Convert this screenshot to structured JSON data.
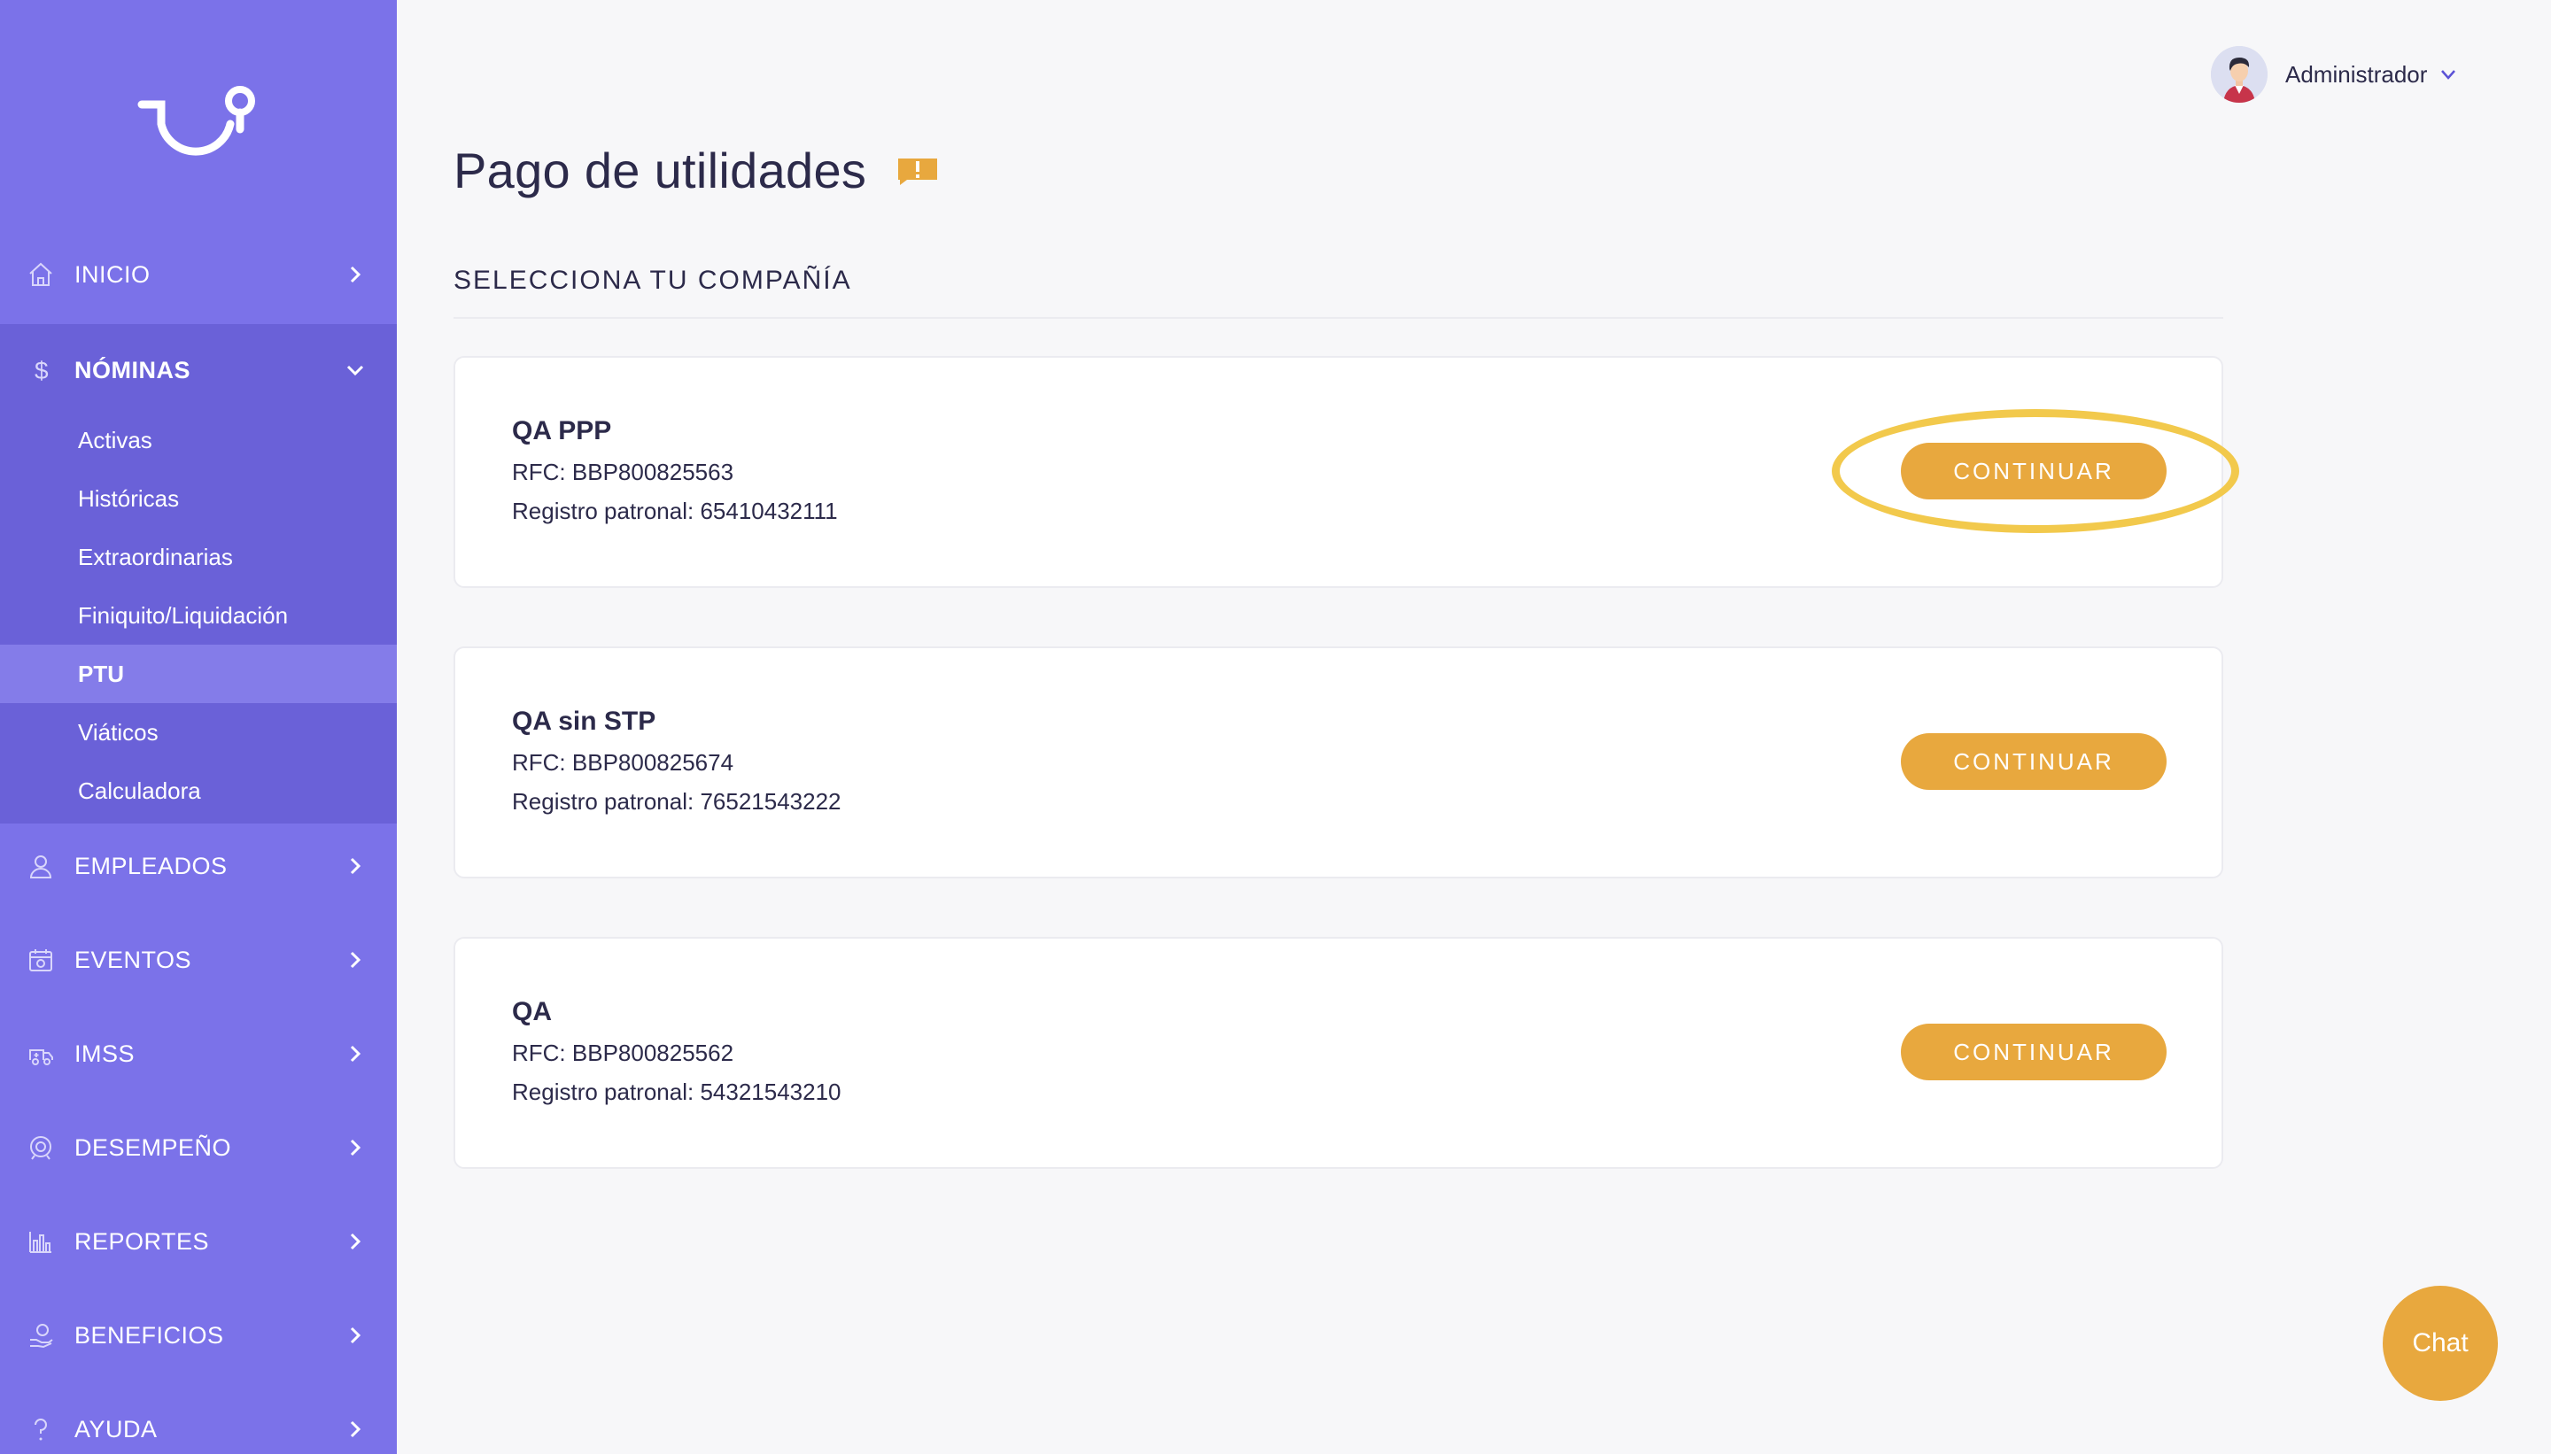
{
  "sidebar": {
    "items": [
      {
        "label": "INICIO",
        "icon": "home-icon"
      },
      {
        "label": "NÓMINAS",
        "icon": "dollar-icon"
      },
      {
        "label": "EMPLEADOS",
        "icon": "user-icon"
      },
      {
        "label": "EVENTOS",
        "icon": "calendar-icon"
      },
      {
        "label": "IMSS",
        "icon": "ambulance-icon"
      },
      {
        "label": "DESEMPEÑO",
        "icon": "performance-icon"
      },
      {
        "label": "REPORTES",
        "icon": "bar-chart-icon"
      },
      {
        "label": "BENEFICIOS",
        "icon": "benefits-icon"
      },
      {
        "label": "AYUDA",
        "icon": "help-icon"
      }
    ],
    "submenu": [
      "Activas",
      "Históricas",
      "Extraordinarias",
      "Finiquito/Liquidación",
      "PTU",
      "Viáticos",
      "Calculadora"
    ],
    "active_submenu": "PTU"
  },
  "header": {
    "user_name": "Administrador"
  },
  "main": {
    "title": "Pago de utilidades",
    "section_title": "SELECCIONA TU COMPAÑÍA",
    "companies": [
      {
        "name": "QA PPP",
        "rfc": "RFC: BBP800825563",
        "registro": "Registro patronal: 65410432111",
        "button": "CONTINUAR"
      },
      {
        "name": "QA sin STP",
        "rfc": "RFC: BBP800825674",
        "registro": "Registro patronal: 76521543222",
        "button": "CONTINUAR"
      },
      {
        "name": "QA",
        "rfc": "RFC: BBP800825562",
        "registro": "Registro patronal: 54321543210",
        "button": "CONTINUAR"
      }
    ]
  },
  "chat": {
    "label": "Chat"
  },
  "colors": {
    "sidebar": "#7b72e9",
    "sidebar_open": "#6a61d8",
    "accent": "#e8a83e",
    "highlight": "#f2c94c",
    "text": "#2c2a4a"
  }
}
